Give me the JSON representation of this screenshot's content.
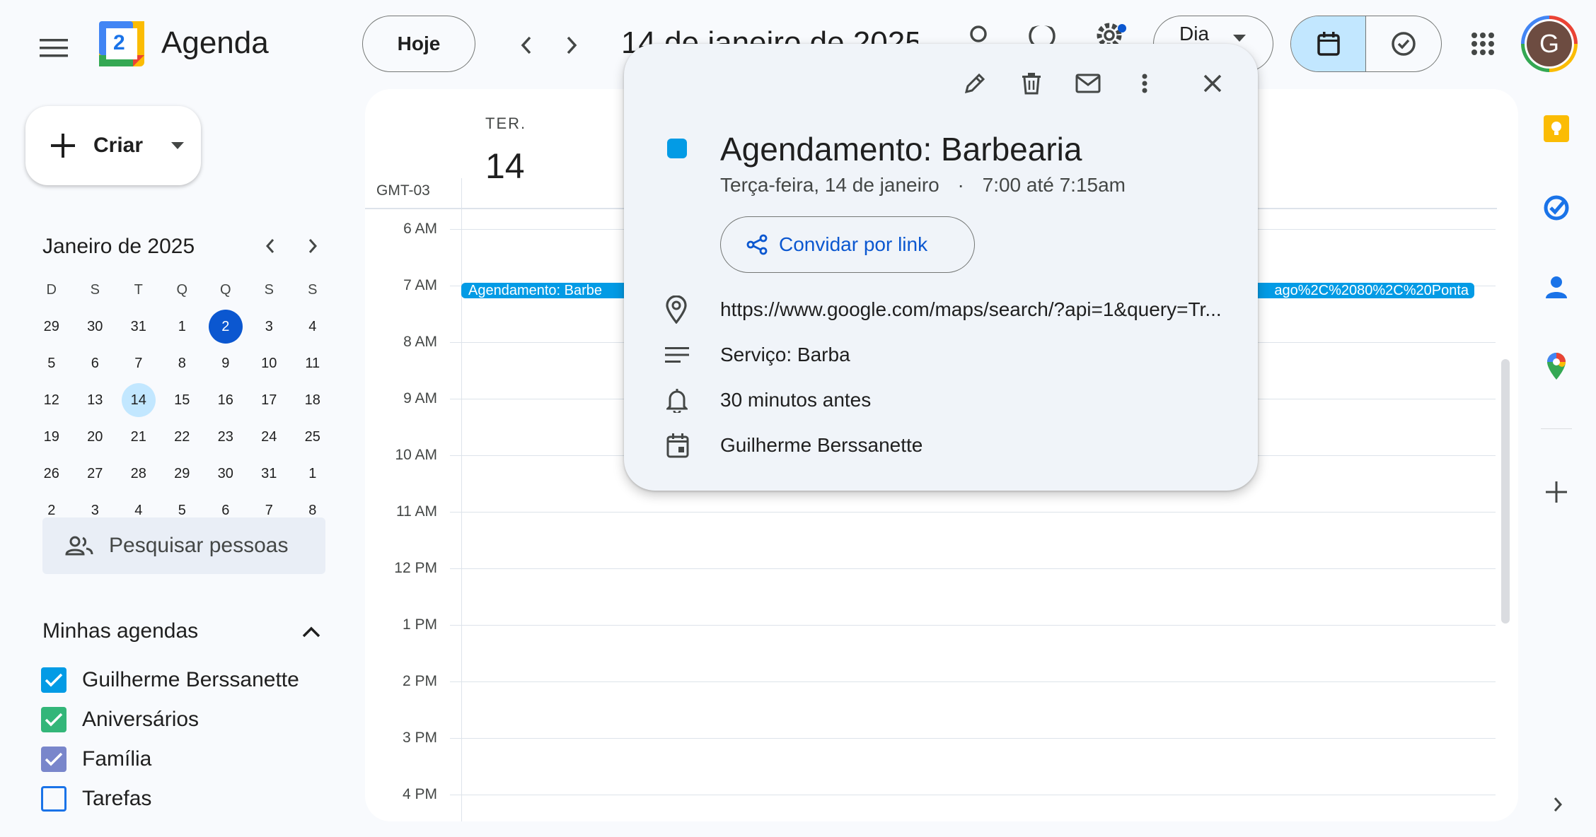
{
  "header": {
    "app_title": "Agenda",
    "logo_text": "2",
    "today_button": "Hoje",
    "date_title": "14 de janeiro de 2025",
    "view_select": "Dia",
    "avatar_letter": "G"
  },
  "create": {
    "label": "Criar"
  },
  "mini_calendar": {
    "title": "Janeiro de 2025",
    "weekday_headers": [
      "D",
      "S",
      "T",
      "Q",
      "Q",
      "S",
      "S"
    ],
    "weeks": [
      [
        "29",
        "30",
        "31",
        "1",
        "2",
        "3",
        "4"
      ],
      [
        "5",
        "6",
        "7",
        "8",
        "9",
        "10",
        "11"
      ],
      [
        "12",
        "13",
        "14",
        "15",
        "16",
        "17",
        "18"
      ],
      [
        "19",
        "20",
        "21",
        "22",
        "23",
        "24",
        "25"
      ],
      [
        "26",
        "27",
        "28",
        "29",
        "30",
        "31",
        "1"
      ],
      [
        "2",
        "3",
        "4",
        "5",
        "6",
        "7",
        "8"
      ]
    ],
    "selected_day": "2",
    "today_day": "14"
  },
  "search_people": {
    "placeholder": "Pesquisar pessoas"
  },
  "my_calendars": {
    "title": "Minhas agendas",
    "items": [
      {
        "label": "Guilherme Berssanette",
        "checked": true,
        "color": "#039be5"
      },
      {
        "label": "Aniversários",
        "checked": true,
        "color": "#33b679"
      },
      {
        "label": "Família",
        "checked": true,
        "color": "#7986cb"
      },
      {
        "label": "Tarefas",
        "checked": false,
        "color": "#1a73e8"
      }
    ]
  },
  "day_view": {
    "weekday": "TER.",
    "day_number": "14",
    "timezone": "GMT-03",
    "hours": [
      "6 AM",
      "7 AM",
      "8 AM",
      "9 AM",
      "10 AM",
      "11 AM",
      "12 PM",
      "1 PM",
      "2 PM",
      "3 PM",
      "4 PM"
    ],
    "event_bar_left": "Agendamento: Barbe",
    "event_bar_right": "ago%2C%2080%2C%20Ponta",
    "event_color": "#039be5"
  },
  "popover": {
    "title": "Agendamento: Barbearia",
    "date_line": "Terça-feira, 14 de janeiro",
    "separator": "·",
    "time_line": "7:00 até 7:15am",
    "invite_label": "Convidar por link",
    "location": "https://www.google.com/maps/search/?api=1&query=Tr...",
    "description": "Serviço: Barba",
    "reminder": "30 minutos antes",
    "calendar": "Guilherme Berssanette",
    "color": "#039be5"
  }
}
